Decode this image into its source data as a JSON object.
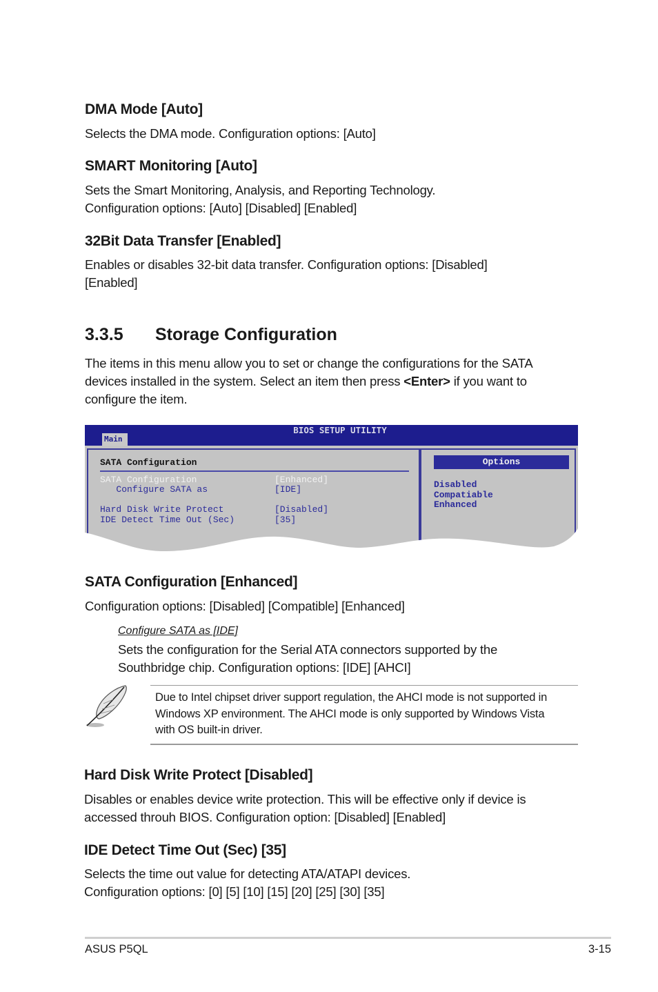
{
  "sections": {
    "dma": {
      "title": "DMA Mode [Auto]",
      "body": "Selects the DMA mode. Configuration options: [Auto]"
    },
    "smart": {
      "title": "SMART Monitoring [Auto]",
      "body1": "Sets the Smart Monitoring, Analysis, and Reporting Technology.",
      "body2": "Configuration options: [Auto] [Disabled] [Enabled]"
    },
    "bit32": {
      "title": "32Bit Data Transfer [Enabled]",
      "body1": "Enables or disables 32-bit data transfer. Configuration options: [Disabled]",
      "body2": "[Enabled]"
    },
    "storage": {
      "number": "3.3.5",
      "title": "Storage Configuration",
      "intro1": "The items in this menu allow you to set or change the configurations for the SATA",
      "intro2_pre": "devices installed in the system. Select an item then press ",
      "intro2_key": "<Enter>",
      "intro2_post": " if you want to",
      "intro3": "configure the item."
    },
    "sata_cfg": {
      "title": "SATA Configuration [Enhanced]",
      "body": "Configuration options: [Disabled] [Compatible] [Enhanced]"
    },
    "configure_sata": {
      "subtitle": "Configure SATA as [IDE]",
      "body1": "Sets the configuration for the Serial ATA connectors supported by the",
      "body2": "Southbridge chip. Configuration options: [IDE] [AHCI]"
    },
    "note": {
      "icon": "feather-pen-icon",
      "line1": "Due to Intel chipset driver support regulation, the AHCI mode is not supported in",
      "line2": "Windows XP environment. The AHCI mode is only supported by Windows Vista",
      "line3": "with OS built-in driver."
    },
    "hdwp": {
      "title": "Hard Disk Write Protect [Disabled]",
      "body1": "Disables or enables device write protection. This will be effective only if device is",
      "body2": "accessed throuh BIOS. Configuration option: [Disabled] [Enabled]"
    },
    "ide": {
      "title": "IDE Detect Time Out (Sec) [35]",
      "body1": "Selects the time out value for detecting ATA/ATAPI devices.",
      "body2": "Configuration options: [0] [5] [10] [15] [20] [25] [30] [35]"
    }
  },
  "bios": {
    "title": "BIOS SETUP UTILITY",
    "tab": "Main",
    "panel_header": "SATA Configuration",
    "items": [
      {
        "label": "SATA Configuration",
        "value": "[Enhanced]",
        "selected": true
      },
      {
        "label": "   Configure SATA as",
        "value": "[IDE]",
        "selected": false
      },
      {
        "label": "Hard Disk Write Protect",
        "value": "[Disabled]",
        "selected": false
      },
      {
        "label": "IDE Detect Time Out (Sec)",
        "value": "[35]",
        "selected": false
      }
    ],
    "options_header": "Options",
    "options": [
      "Disabled",
      "Compatiable",
      "Enhanced"
    ],
    "colors": {
      "bar": "#1d1d8e",
      "panel": "#c4c4c4",
      "text": "#2b2b9a",
      "selected": "#f2f2f2"
    }
  },
  "footer": {
    "left": "ASUS P5QL",
    "right": "3-15"
  }
}
